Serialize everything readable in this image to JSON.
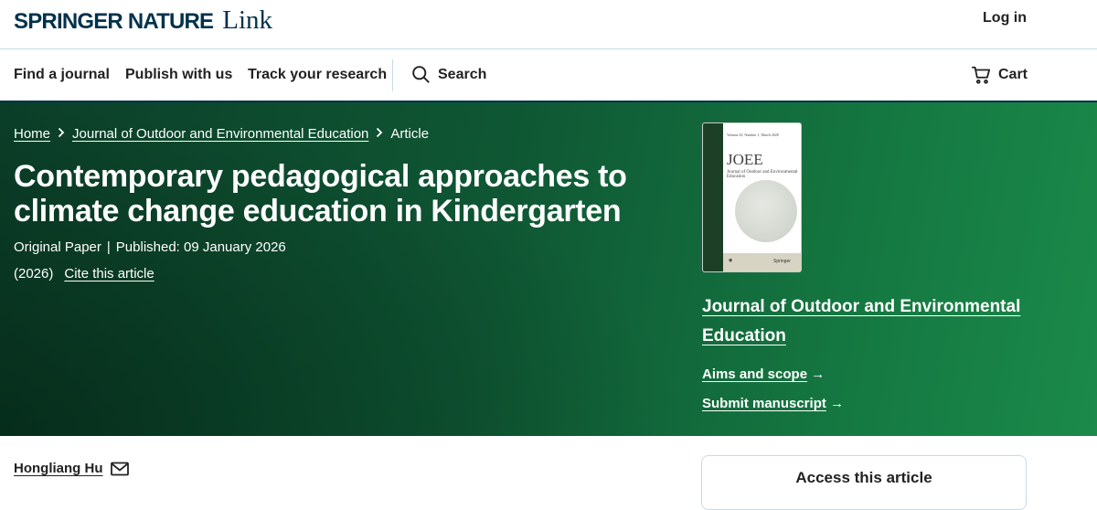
{
  "header": {
    "logo_brand_a": "Springer",
    "logo_brand_b": "Nature",
    "logo_product": "Link",
    "login_label": "Log in"
  },
  "nav": {
    "find_journal": "Find a journal",
    "publish": "Publish with us",
    "track": "Track your research",
    "search": "Search",
    "cart": "Cart"
  },
  "breadcrumb": {
    "home": "Home",
    "journal": "Journal of Outdoor and Environmental Education",
    "current": "Article"
  },
  "article": {
    "title": "Contemporary pedagogical approaches to climate change education in Kindergarten",
    "type": "Original Paper",
    "published": "Published: 09 January 2026",
    "year": "(2026)",
    "cite": "Cite this article",
    "author": "Hongliang Hu"
  },
  "journal_panel": {
    "cover_abbr": "JOEE",
    "cover_name": "Journal of Outdoor and Environmental Education",
    "cover_volume": "Volume 23, Number 1, March 2020",
    "cover_publisher": "Springer",
    "name": "Journal of Outdoor and Environmental Education",
    "aims": "Aims and scope",
    "submit": "Submit manuscript"
  },
  "access": {
    "label": "Access this article"
  },
  "colors": {
    "brand_navy": "#01324b",
    "hero_green": "#0f5734"
  }
}
